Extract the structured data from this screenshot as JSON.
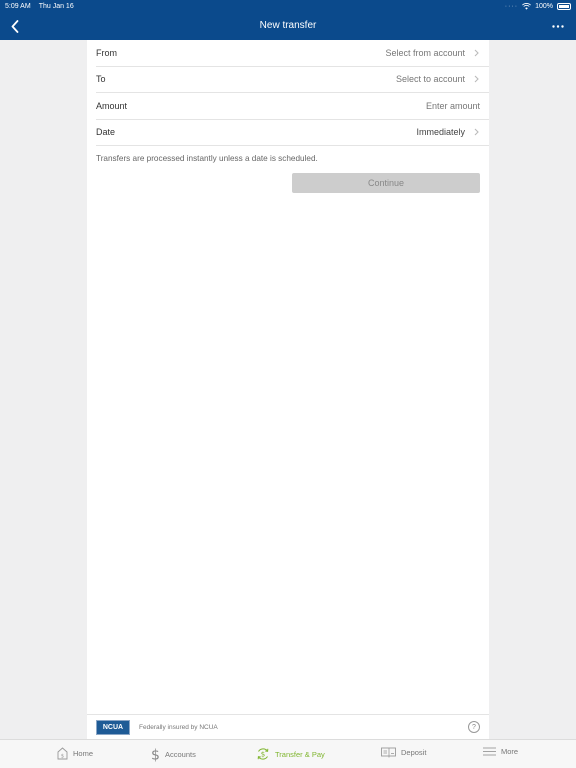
{
  "status_bar": {
    "time": "5:09 AM",
    "date": "Thu Jan 16",
    "battery": "100%"
  },
  "nav": {
    "title": "New transfer"
  },
  "form": {
    "rows": [
      {
        "label": "From",
        "value": "Select from account"
      },
      {
        "label": "To",
        "value": "Select to account"
      },
      {
        "label": "Amount",
        "value": "Enter amount"
      },
      {
        "label": "Date",
        "value": "Immediately"
      }
    ],
    "note": "Transfers are processed instantly unless a date is scheduled.",
    "continue_label": "Continue"
  },
  "footer": {
    "badge": "NCUA",
    "text": "Federally insured by NCUA",
    "help": "?"
  },
  "tabs": [
    {
      "label": "Home",
      "icon": "home-icon"
    },
    {
      "label": "Accounts",
      "icon": "dollar-icon"
    },
    {
      "label": "Transfer & Pay",
      "icon": "transfer-icon",
      "active": true
    },
    {
      "label": "Deposit",
      "icon": "check-deposit-icon"
    },
    {
      "label": "More",
      "icon": "menu-icon"
    }
  ],
  "colors": {
    "brand": "#0b4a8c",
    "active_tab": "#7fb52e",
    "button_disabled": "#cdcdcd"
  }
}
